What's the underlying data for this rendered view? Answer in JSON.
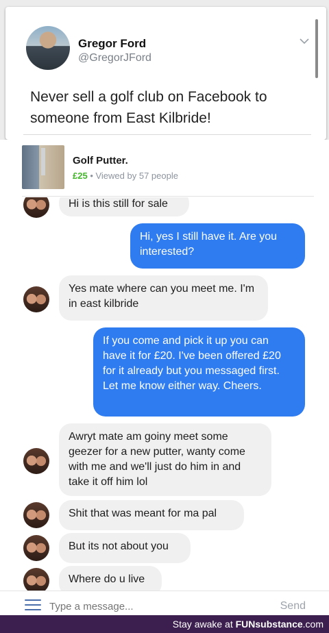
{
  "tweet": {
    "name": "Gregor Ford",
    "handle": "@GregorJFord",
    "text": "Never sell a golf club on Facebook to someone from East Kilbride!"
  },
  "listing": {
    "title": "Golf Putter.",
    "price": "£25",
    "separator": " • ",
    "views": "Viewed by 57 people"
  },
  "messages": [
    {
      "from": "buyer",
      "text": "Hi is this still for sale"
    },
    {
      "from": "seller",
      "text": "Hi, yes I still have it. Are you interested?"
    },
    {
      "from": "buyer",
      "text": "Yes mate where can you meet me. I'm in east kilbride"
    },
    {
      "from": "seller",
      "text": "If you come and pick it up you can have it for £20. I've been offered £20 for it already but you messaged first. Let me know either way. Cheers."
    },
    {
      "from": "buyer",
      "text": "Awryt mate am goiny meet some geezer for a new putter, wanty come with me and we'll just do him in and take it off him lol"
    },
    {
      "from": "buyer",
      "text": "Shit that was meant for ma pal"
    },
    {
      "from": "buyer",
      "text": "But its not about you"
    },
    {
      "from": "buyer",
      "text": "Where do u live"
    }
  ],
  "composer": {
    "placeholder": "Type a message...",
    "send_label": "Send"
  },
  "watermark": {
    "prefix": "Stay awake at ",
    "brand": "FUNsubstance",
    "suffix": ".com"
  },
  "colors": {
    "outgoing_bubble": "#2e7cf0",
    "incoming_bubble": "#f1f0f0",
    "price": "#42b72a",
    "footer": "#3d1f4f"
  },
  "icons": [
    "chevron-down-icon",
    "menu-icon"
  ]
}
